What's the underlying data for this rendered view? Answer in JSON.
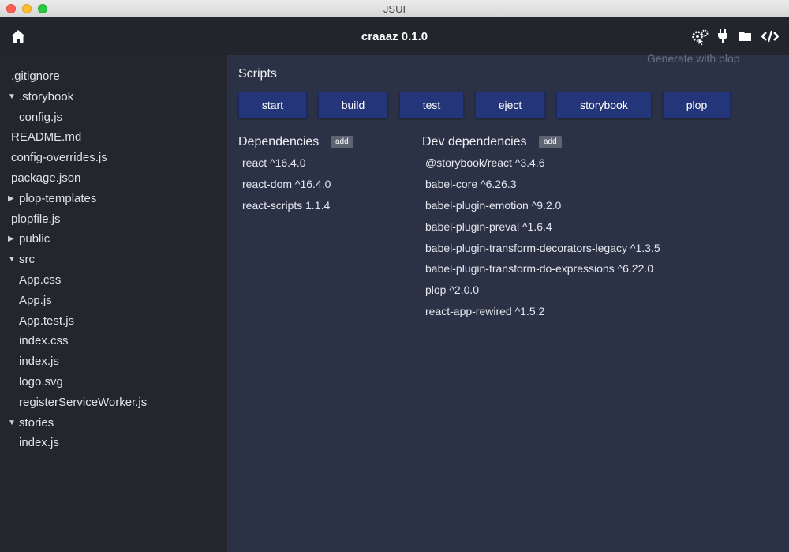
{
  "window": {
    "title": "JSUI"
  },
  "header": {
    "app_title": "craaaz 0.1.0",
    "tooltip": "Generate with plop",
    "icons": [
      "home-icon",
      "generator-gears-icon",
      "plug-icon",
      "folder-icon",
      "code-icon"
    ]
  },
  "sidebar": {
    "items": [
      {
        "label": ".gitignore",
        "depth": 0,
        "arrow": ""
      },
      {
        "label": ".storybook",
        "depth": 0,
        "arrow": "▼"
      },
      {
        "label": "config.js",
        "depth": 1,
        "arrow": ""
      },
      {
        "label": "README.md",
        "depth": 0,
        "arrow": ""
      },
      {
        "label": "config-overrides.js",
        "depth": 0,
        "arrow": ""
      },
      {
        "label": "package.json",
        "depth": 0,
        "arrow": ""
      },
      {
        "label": "plop-templates",
        "depth": 0,
        "arrow": "▶"
      },
      {
        "label": "plopfile.js",
        "depth": 0,
        "arrow": ""
      },
      {
        "label": "public",
        "depth": 0,
        "arrow": "▶"
      },
      {
        "label": "src",
        "depth": 0,
        "arrow": "▼"
      },
      {
        "label": "App.css",
        "depth": 1,
        "arrow": ""
      },
      {
        "label": "App.js",
        "depth": 1,
        "arrow": ""
      },
      {
        "label": "App.test.js",
        "depth": 1,
        "arrow": ""
      },
      {
        "label": "index.css",
        "depth": 1,
        "arrow": ""
      },
      {
        "label": "index.js",
        "depth": 1,
        "arrow": ""
      },
      {
        "label": "logo.svg",
        "depth": 1,
        "arrow": ""
      },
      {
        "label": "registerServiceWorker.js",
        "depth": 1,
        "arrow": ""
      },
      {
        "label": "stories",
        "depth": 0,
        "arrow": "▼"
      },
      {
        "label": "index.js",
        "depth": 1,
        "arrow": ""
      }
    ]
  },
  "main": {
    "scripts_title": "Scripts",
    "scripts": [
      "start",
      "build",
      "test",
      "eject",
      "storybook",
      "plop"
    ],
    "dependencies": {
      "title": "Dependencies",
      "add_label": "add",
      "items": [
        "react ^16.4.0",
        "react-dom ^16.4.0",
        "react-scripts 1.1.4"
      ]
    },
    "dev_dependencies": {
      "title": "Dev dependencies",
      "add_label": "add",
      "items": [
        "@storybook/react ^3.4.6",
        "babel-core ^6.26.3",
        "babel-plugin-emotion ^9.2.0",
        "babel-plugin-preval ^1.6.4",
        "babel-plugin-transform-decorators-legacy ^1.3.5",
        "babel-plugin-transform-do-expressions ^6.22.0",
        "plop ^2.0.0",
        "react-app-rewired ^1.5.2"
      ]
    }
  },
  "colors": {
    "sidebar_bg": "#23272d",
    "main_bg": "#2c3246",
    "header_bg": "#22252c",
    "script_button": "#25357a",
    "add_button": "#5d6472"
  }
}
